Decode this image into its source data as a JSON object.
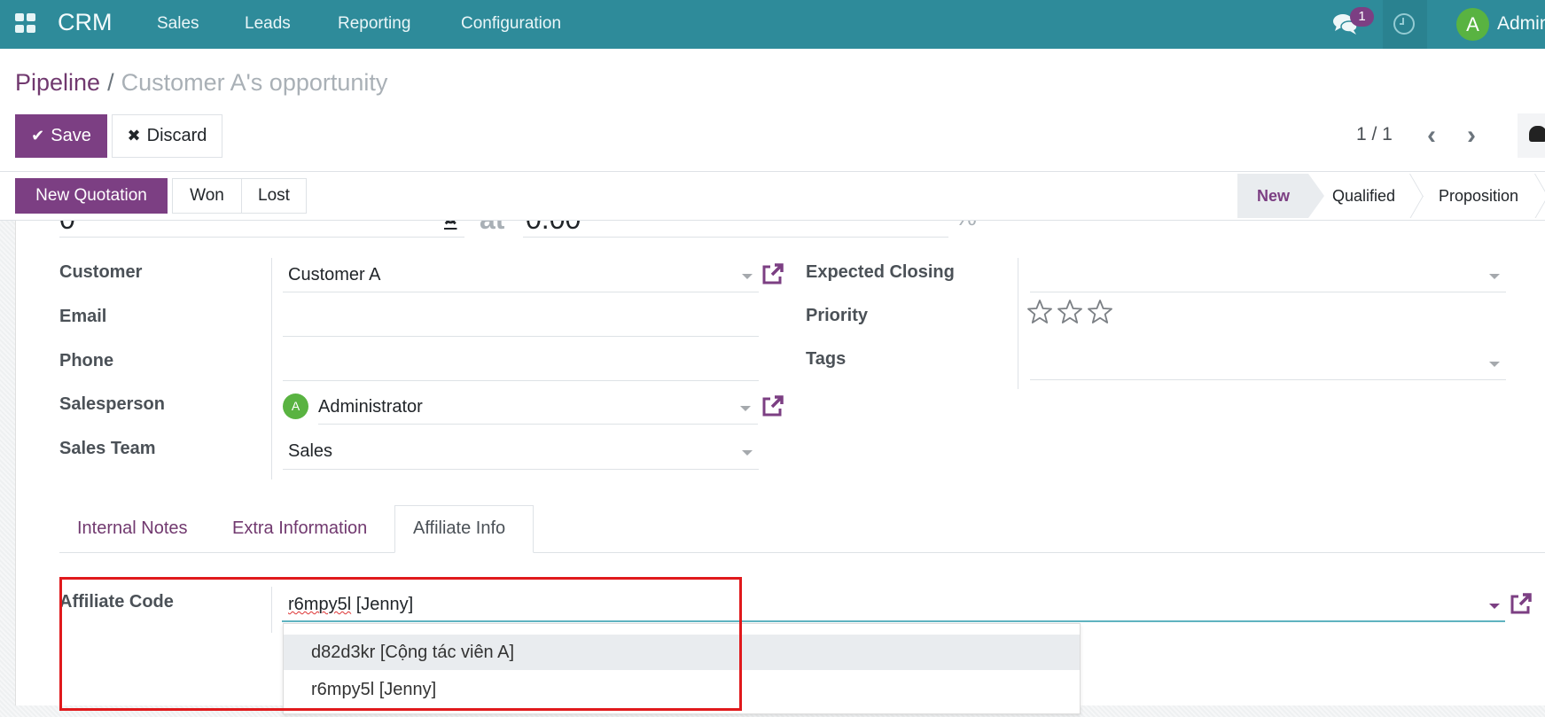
{
  "navbar": {
    "brand": "CRM",
    "menu": [
      "Sales",
      "Leads",
      "Reporting",
      "Configuration"
    ],
    "chat_badge": "1",
    "user_initial": "A",
    "user_name": "Administrator",
    "colors": {
      "bar": "#2e8b9a",
      "badge": "#7c3f83",
      "avatar": "#59b341"
    }
  },
  "breadcrumb": {
    "parent": "Pipeline",
    "separator": "/",
    "current": "Customer A's opportunity"
  },
  "toolbar": {
    "save_label": "Save",
    "discard_label": "Discard",
    "pager": "1 / 1"
  },
  "header_buttons": {
    "new_quotation": "New Quotation",
    "won": "Won",
    "lost": "Lost"
  },
  "statusbar": {
    "stages": [
      "New",
      "Qualified",
      "Proposition"
    ],
    "active_stage": "New"
  },
  "partial_row": {
    "revenue": "0",
    "at_label": "at",
    "probability": "0.00",
    "percent": "%"
  },
  "form": {
    "left": [
      {
        "label": "Customer",
        "value": "Customer A"
      },
      {
        "label": "Email",
        "value": ""
      },
      {
        "label": "Phone",
        "value": ""
      },
      {
        "label": "Salesperson",
        "value": "Administrator",
        "avatar": "A"
      },
      {
        "label": "Sales Team",
        "value": "Sales"
      }
    ],
    "right": [
      {
        "label": "Expected Closing",
        "value": ""
      },
      {
        "label": "Priority",
        "stars_total": 3,
        "stars_filled": 0
      },
      {
        "label": "Tags",
        "value": ""
      }
    ]
  },
  "tabs": {
    "items": [
      "Internal Notes",
      "Extra Information",
      "Affiliate Info"
    ],
    "active": "Affiliate Info"
  },
  "affiliate": {
    "label": "Affiliate Code",
    "value_code": "r6mpy5l",
    "value_name": " [Jenny]",
    "dropdown": [
      {
        "label": "d82d3kr [Cộng tác viên A]",
        "highlighted": true
      },
      {
        "label": "r6mpy5l [Jenny]",
        "highlighted": false
      }
    ]
  },
  "colors": {
    "primary": "#7c3f83",
    "link": "#71396f",
    "highlight_box": "#e0191c"
  }
}
